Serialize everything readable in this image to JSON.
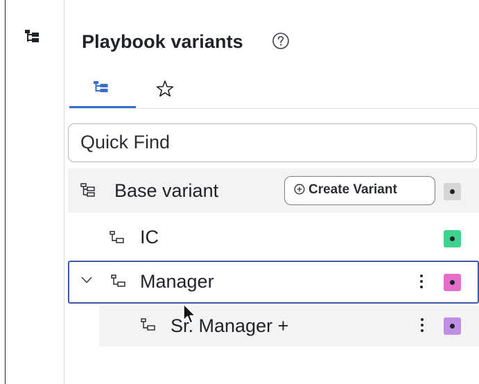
{
  "panel": {
    "title": "Playbook variants",
    "help_icon": "question-circle-icon",
    "tabs": [
      {
        "icon": "tree-icon",
        "active": true
      },
      {
        "icon": "star-icon",
        "active": false
      }
    ]
  },
  "search": {
    "placeholder": "Quick Find"
  },
  "variants": {
    "base": {
      "label": "Base variant",
      "create_button": "Create Variant",
      "color": "#d6d6d6"
    },
    "ic": {
      "label": "IC",
      "color": "#3fd28f"
    },
    "manager": {
      "label": "Manager",
      "color": "#e36fc8",
      "expanded": true,
      "selected": true
    },
    "sr_manager": {
      "label": "Sr. Manager +",
      "color": "#bf8fe6"
    }
  },
  "colors": {
    "accent": "#3d6cc8",
    "selection_border": "#3d58a8"
  }
}
